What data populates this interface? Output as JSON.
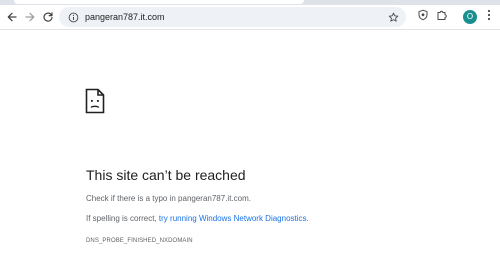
{
  "toolbar": {
    "url": "pangeran787.it.com",
    "avatar_letter": "O"
  },
  "error": {
    "title": "This site can’t be reached",
    "line1": "Check if there is a typo in pangeran787.it.com.",
    "line2_prefix": "If spelling is correct, ",
    "line2_link": "try running Windows Network Diagnostics",
    "line2_suffix": ".",
    "code": "DNS_PROBE_FINISHED_NXDOMAIN"
  },
  "icons": {
    "back": "back-arrow-icon",
    "forward": "forward-arrow-icon",
    "reload": "reload-icon",
    "site_info": "site-info-icon",
    "bookmark": "star-icon",
    "extension_shield": "shield-icon",
    "extensions": "puzzle-icon",
    "menu": "kebab-menu-icon",
    "sad_page": "sad-page-icon"
  },
  "colors": {
    "link": "#1a73e8",
    "avatar": "#1a8f8f",
    "omnibox": "#eef1f6"
  }
}
